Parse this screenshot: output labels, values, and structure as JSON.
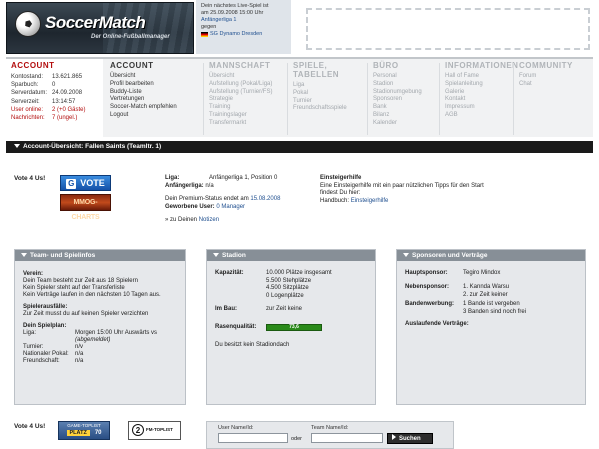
{
  "header": {
    "brand_left": "Soccer",
    "brand_right": "Match",
    "tagline": "Der Online-Fußballmanager",
    "live": {
      "line1": "Dein nächstes Live-Spiel ist",
      "line2": "am 25.09.2008 15:00 Uhr",
      "league": "Anfängerliga 1",
      "opponent_prefix": "gegen",
      "opponent": "SG Dynamo Dresden"
    }
  },
  "nav": {
    "account": {
      "title": "ACCOUNT",
      "rows": [
        {
          "k": "Kontostand:",
          "v": "13.621.865"
        },
        {
          "k": "Sparbuch:",
          "v": "0"
        },
        {
          "k": "Serverdatum:",
          "v": "24.09.2008"
        },
        {
          "k": "Serverzeit:",
          "v": "13:14:57"
        },
        {
          "k": "User online:",
          "v": "2 (+0 Gäste)"
        },
        {
          "k": "Nachrichten:",
          "v": "7 (ungel.)"
        }
      ]
    },
    "account2": {
      "title": "ACCOUNT",
      "items": [
        "Übersicht",
        "Profil bearbeiten",
        "Buddy-Liste",
        "Vertretungen",
        "Soccer-Match empfehlen",
        "Logout"
      ]
    },
    "mannschaft": {
      "title": "MANNSCHAFT",
      "items": [
        "Übersicht",
        "Aufstellung (Pokal/Liga)",
        "Aufstellung (Turnier/FS)",
        "Strategie",
        "Training",
        "Trainingslager",
        "Transfermarkt"
      ]
    },
    "spiele": {
      "title": "SPIELE, TABELLEN",
      "items": [
        "Liga",
        "Pokal",
        "Turnier",
        "Freundschaftsspiele"
      ]
    },
    "buero": {
      "title": "BÜRO",
      "items": [
        "Personal",
        "Stadion",
        "Stadionumgebung",
        "Sponsoren",
        "Bank",
        "Bilanz",
        "Kalender"
      ]
    },
    "informationen": {
      "title": "INFORMATIONEN",
      "items": [
        "Hall of Fame",
        "Spielanleitung",
        "Galerie",
        "Kontakt",
        "Impressum",
        "AGB"
      ]
    },
    "community": {
      "title": "COMMUNITY",
      "items": [
        "Forum",
        "Chat"
      ]
    }
  },
  "title_bar": "Account-Übersicht: Fallen Saints (Teamltr. 1)",
  "vote": {
    "label": "Vote 4 Us!",
    "gvote": "VOTE",
    "gvote_letter": "G",
    "mmog": "MMOG-CHARTS"
  },
  "overview": {
    "liga_k": "Liga:",
    "liga_v": "Anfängerliga 1, Position 0",
    "anf_k": "Anfängerliga:",
    "anf_v": "n/a",
    "premium": "Dein Premium-Status endet am",
    "premium_date": "15.08.2008",
    "geworben_k": "Geworbene User:",
    "geworben_v": "0 Manager",
    "notizen_prefix": "» zu Deinen",
    "notizen_link": "Notizen"
  },
  "help": {
    "title": "Einsteigerhilfe",
    "line1": "Eine Einsteigerhilfe mit ein paar nützlichen Tipps für den Start",
    "line2": "findest Du hier:",
    "link_prefix": "Handbuch:",
    "link": "Einsteigerhilfe"
  },
  "team_box": {
    "header": "Team- und Spielinfos",
    "verein_title": "Verein:",
    "verein": [
      "Dein Team besteht zur Zeit aus 18 Spielern",
      "Kein Spieler steht auf der Transferliste",
      "Kein Verträge laufen in den nächsten 10 Tagen aus."
    ],
    "ausfaelle_title": "Spielerausfälle:",
    "ausfaelle": "Zur Zeit musst du auf keinen Spieler verzichten",
    "spielplan_title": "Dein Spielplan:",
    "rows": [
      {
        "k": "Liga:",
        "v": "Morgen 15:00 Uhr Auswärts vs",
        "v2": "(abgemeldet)"
      },
      {
        "k": "Turnier:",
        "v": "n/v",
        "v2": ""
      },
      {
        "k": "Nationaler Pokal:",
        "v": "n/a",
        "v2": ""
      },
      {
        "k": "Freundschaft:",
        "v": "n/a",
        "v2": ""
      }
    ]
  },
  "stadion_box": {
    "header": "Stadion",
    "kap_k": "Kapazität:",
    "kap": [
      "10.000 Plätze insgesamt",
      "5.500 Stehplätze",
      "4.500 Sitzplätze",
      "0 Logenplätze"
    ],
    "bau_k": "Im Bau:",
    "bau_v": "zur Zeit keine",
    "rasen_k": "Rasenqualität:",
    "rasen_v": "73,6",
    "rasen_fraction": 0.736,
    "dach": "Du besitzt kein Stadiondach"
  },
  "sponsor_box": {
    "header": "Sponsoren und Verträge",
    "haupt_k": "Hauptsponsor:",
    "haupt_v": "Tegiro Mindox",
    "neben_k": "Nebensponsor:",
    "neben": [
      "1. Kannda Warsu",
      "2. zur Zeit keiner"
    ],
    "band_k": "Bandenwerbung:",
    "band": [
      "1 Bande ist vergeben",
      "3 Banden sind noch frei"
    ],
    "auslauf_k": "Auslaufende Verträge:"
  },
  "bottom": {
    "vote_label": "Vote 4 Us!",
    "gtop_line1": "GAME-TOPLIST",
    "gtop_platz": "PLATZ",
    "gtop_rank": "70",
    "fm_text": "FM-TOPLIST",
    "fm_num": "2",
    "login": {
      "user_label": "User Name/Id:",
      "team_label": "Team Name/Id:",
      "oder": "oder",
      "button": "Suchen"
    }
  },
  "colors": {
    "accent_red": "#b30d0d",
    "link_blue": "#1f4f8f",
    "box_header": "#878f97"
  }
}
